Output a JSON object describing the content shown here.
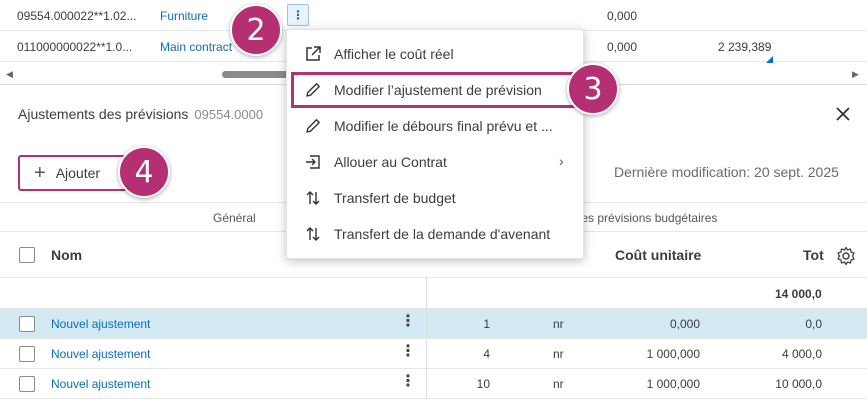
{
  "top_table": {
    "rows": [
      {
        "code": "09554.000022**1.02...",
        "name": "Furniture",
        "value": "0,000",
        "total": ""
      },
      {
        "code": "011000000022**1.0...",
        "name": "Main contract",
        "value": "0,000",
        "total": "2 239,389"
      }
    ]
  },
  "context_menu": {
    "items": [
      {
        "label": "Afficher le coût réel",
        "icon": "open-external-icon"
      },
      {
        "label": "Modifier l’ajustement de prévision",
        "icon": "pencil-icon"
      },
      {
        "label": "Modifier le débours final prévu et ...",
        "icon": "pencil-icon"
      },
      {
        "label": "Allouer au Contrat",
        "icon": "allocate-icon"
      },
      {
        "label": "Transfert de budget",
        "icon": "transfer-icon"
      },
      {
        "label": "Transfert de la demande d'avenant",
        "icon": "transfer-icon"
      }
    ]
  },
  "panel": {
    "title": "Ajustements des prévisions",
    "subtitle": "09554.0000",
    "add_label": "Ajouter",
    "last_modified": "Dernière modification: 20 sept. 2025",
    "groups": {
      "general": "Général",
      "forecast": "t des prévisions budgétaires"
    },
    "columns": {
      "name": "Nom",
      "unit_cost": "Coût unitaire",
      "total": "Tot"
    },
    "sum_total": "14 000,0",
    "rows": [
      {
        "name": "Nouvel ajustement",
        "qty": "1",
        "unit": "nr",
        "unit_cost": "0,000",
        "total": "0,0",
        "selected": true
      },
      {
        "name": "Nouvel ajustement",
        "qty": "4",
        "unit": "nr",
        "unit_cost": "1 000,000",
        "total": "4 000,0",
        "selected": false
      },
      {
        "name": "Nouvel ajustement",
        "qty": "10",
        "unit": "nr",
        "unit_cost": "1 000,000",
        "total": "10 000,0",
        "selected": false
      }
    ]
  },
  "callouts": [
    "2",
    "3",
    "4"
  ],
  "colors": {
    "accent": "#b43073",
    "link": "#0b6fb3",
    "selected_row": "#d3eaf5"
  }
}
